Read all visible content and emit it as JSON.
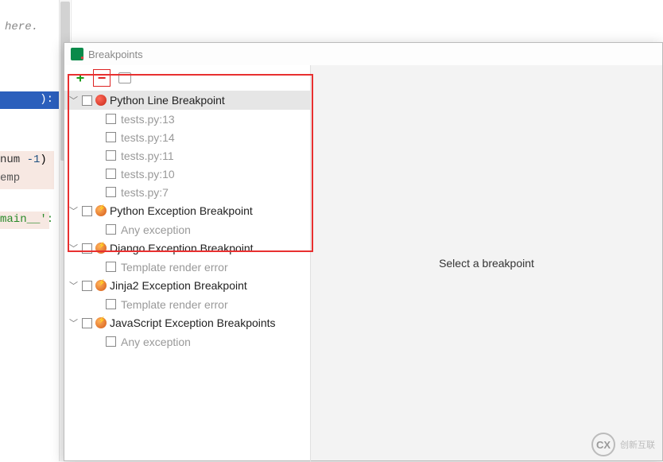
{
  "editor": {
    "hereText": "here.",
    "lineParen": "):",
    "block1_num": "num ",
    "block1_minus": "-1",
    "block1_paren": ")",
    "block1_l2": "emp",
    "mainText": "main__':"
  },
  "dialog": {
    "title": "Breakpoints"
  },
  "rightPanel": {
    "placeholder": "Select a breakpoint"
  },
  "tree": {
    "groups": [
      {
        "label": "Python Line Breakpoint",
        "dot": "red",
        "highlight": true,
        "children": [
          {
            "label": "tests.py:13"
          },
          {
            "label": "tests.py:14"
          },
          {
            "label": "tests.py:11"
          },
          {
            "label": "tests.py:10"
          },
          {
            "label": "tests.py:7"
          }
        ]
      },
      {
        "label": "Python Exception Breakpoint",
        "dot": "orange",
        "highlight": false,
        "children": [
          {
            "label": "Any exception"
          }
        ]
      },
      {
        "label": "Django Exception Breakpoint",
        "dot": "orange",
        "highlight": false,
        "children": [
          {
            "label": "Template render error"
          }
        ]
      },
      {
        "label": "Jinja2 Exception Breakpoint",
        "dot": "orange",
        "highlight": false,
        "children": [
          {
            "label": "Template render error"
          }
        ]
      },
      {
        "label": "JavaScript Exception Breakpoints",
        "dot": "orange",
        "highlight": false,
        "children": [
          {
            "label": "Any exception"
          }
        ]
      }
    ]
  },
  "watermark": {
    "logo": "CX",
    "text": "创新互联"
  }
}
